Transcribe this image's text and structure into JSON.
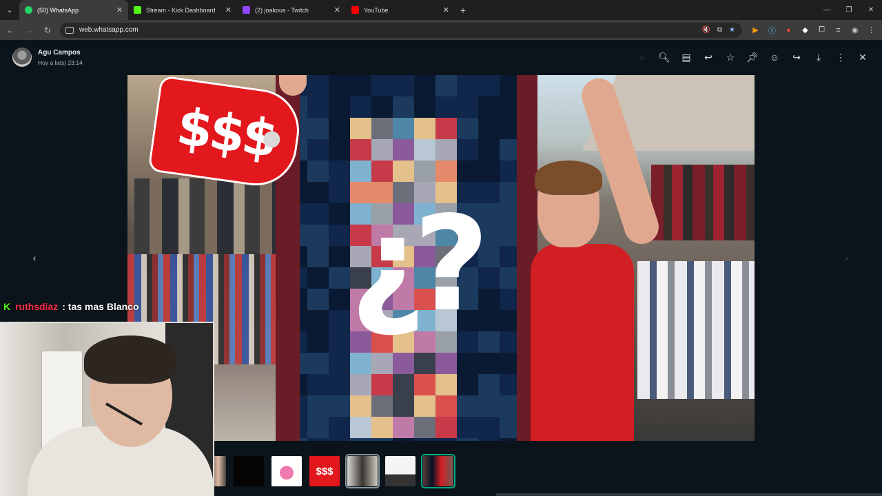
{
  "browser": {
    "tabs": [
      {
        "title": "(50) WhatsApp",
        "favicon_color": "#25d366",
        "active": true
      },
      {
        "title": "Stream - Kick Dashboard",
        "favicon_color": "#53fc18",
        "active": false
      },
      {
        "title": "(2) joakous - Twitch",
        "favicon_color": "#9146ff",
        "active": false
      },
      {
        "title": "YouTube",
        "favicon_color": "#ff0000",
        "active": false
      }
    ],
    "url": "web.whatsapp.com"
  },
  "viewer": {
    "sender_name": "Agu Campos",
    "sent_time": "Hoy a la(s) 23:14",
    "tools": [
      "search-icon",
      "zoom-in-icon",
      "caption-icon",
      "reply-icon",
      "star-icon",
      "pin-icon",
      "emoji-icon",
      "forward-icon",
      "download-icon",
      "more-icon",
      "close-icon"
    ],
    "image": {
      "price_tag_text": "$$$",
      "overlay_text": "¿?"
    },
    "thumbnails": [
      "thumb-person",
      "thumb-black",
      "thumb-minnie",
      "thumb-price",
      "thumb-webcam",
      "thumb-screenshot",
      "thumb-current"
    ]
  },
  "stream_overlay": {
    "chat_user": "ruthsdiaz",
    "chat_message": ": tas mas Blanco"
  },
  "colors": {
    "whatsapp_green": "#00a884",
    "kick_green": "#53fc18",
    "price_red": "#e3181d",
    "shirt_red": "#d21f24"
  }
}
